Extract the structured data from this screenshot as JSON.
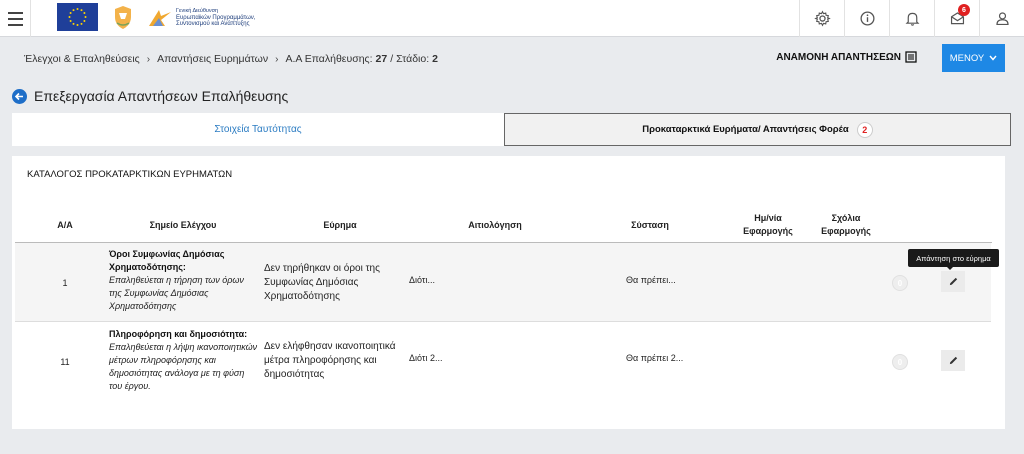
{
  "header": {
    "logo_text_lines": [
      "Γενική Διεύθυνση",
      "Ευρωπαϊκών Προγραμμάτων,",
      "Συντονισμού και Ανάπτυξης"
    ],
    "notification_count": "6"
  },
  "breadcrumb": {
    "items": [
      "Έλεγχοι & Επαληθεύσεις",
      "Απαντήσεις Ευρημάτων"
    ],
    "verification_label": "Α.Α Επαλήθευσης:",
    "verification_id": "27",
    "separator": "/",
    "stage_label": "Στάδιο:",
    "stage_value": "2"
  },
  "pending_label": "ΑΝΑΜΟΝΗ ΑΠΑΝΤΗΣΕΩΝ",
  "menu_label": "ΜΕΝΟΥ",
  "page_title": "Επεξεργασία Απαντήσεων Επαλήθευσης",
  "tabs": [
    {
      "label": "Στοιχεία Ταυτότητας"
    },
    {
      "label": "Προκαταρκτικά Ευρήματα/ Απαντήσεις Φορέα",
      "badge": "2"
    }
  ],
  "card": {
    "title": "ΚΑΤΑΛΟΓΟΣ ΠΡΟΚΑΤΑΡΚΤΙΚΩΝ ΕΥΡΗΜΑΤΩΝ",
    "columns": {
      "aa": "Α/Α",
      "point": "Σημείο Ελέγχου",
      "finding": "Εύρημα",
      "justification": "Αιτιολόγηση",
      "recommendation": "Σύσταση",
      "date_line1": "Ημ/νία",
      "date_line2": "Εφαρμογής",
      "comments_line1": "Σχόλια",
      "comments_line2": "Εφαρμογής"
    },
    "rows": [
      {
        "aa": "1",
        "point_title": "Όροι Συμφωνίας Δημόσιας Χρηματοδότησης:",
        "point_desc": "Επαληθεύεται η τήρηση των όρων της Συμφωνίας Δημόσιας Χρηματοδότησης",
        "finding": "Δεν τηρήθηκαν οι όροι της Συμφωνίας Δημόσιας Χρηματοδότησης",
        "justification": "Διότι...",
        "recommendation": "Θα πρέπει...",
        "comment_count": "0"
      },
      {
        "aa": "11",
        "point_title": "Πληροφόρηση και δημοσιότητα:",
        "point_desc": "Επαληθεύεται η λήψη ικανοποιητικών μέτρων πληροφόρησης και δημοσιότητας ανάλογα με τη φύση του έργου.",
        "finding": "Δεν ελήφθησαν ικανοποιητικά μέτρα πληροφόρησης και δημοσιότητας",
        "justification": "Διότι 2...",
        "recommendation": "Θα πρέπει 2...",
        "comment_count": "0"
      }
    ]
  },
  "tooltip_text": "Απάντηση στο εύρημα",
  "colors": {
    "primary": "#1e88e5",
    "badge_red": "#e02020",
    "link_blue": "#2a7bc2"
  }
}
